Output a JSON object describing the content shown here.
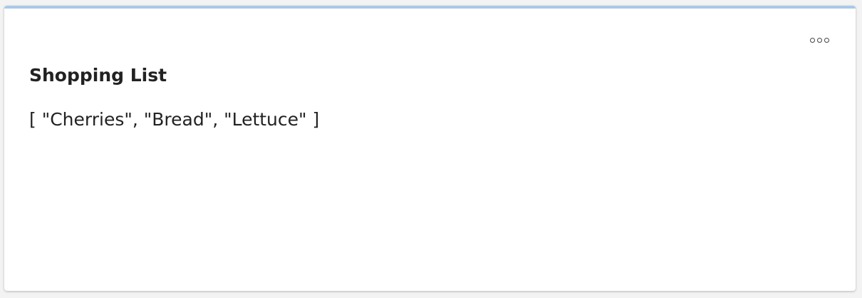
{
  "card": {
    "title": "Shopping List",
    "value_text": "[ \"Cherries\", \"Bread\", \"Lettuce\" ]",
    "more_icon": "more-horizontal-icon",
    "accent_color": "#a9c8e8"
  }
}
